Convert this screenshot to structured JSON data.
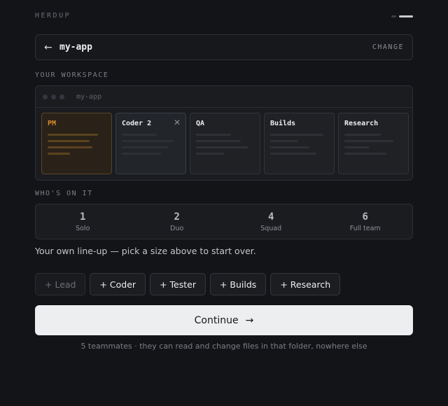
{
  "brand": "HERDUP",
  "repo": {
    "back_icon": "arrow-left-icon",
    "back_glyph": "←",
    "name": "my-app",
    "change_label": "CHANGE"
  },
  "workspace": {
    "label": "YOUR WORKSPACE",
    "window_title": "my-app",
    "panes": [
      {
        "title": "PM",
        "active": true
      },
      {
        "title": "Coder 2",
        "closable": true
      },
      {
        "title": "QA"
      },
      {
        "title": "Builds"
      },
      {
        "title": "Research"
      }
    ],
    "close_glyph": "✕"
  },
  "team": {
    "label": "WHO'S ON IT",
    "sizes": [
      {
        "count": "1",
        "name": "Solo"
      },
      {
        "count": "2",
        "name": "Duo"
      },
      {
        "count": "4",
        "name": "Squad"
      },
      {
        "count": "6",
        "name": "Full team"
      }
    ]
  },
  "lineup_note": "Your own line-up — pick a size above to start over.",
  "roles": [
    {
      "label": "+ Lead",
      "disabled": true
    },
    {
      "label": "+ Coder"
    },
    {
      "label": "+ Tester"
    },
    {
      "label": "+ Builds"
    },
    {
      "label": "+ Research"
    }
  ],
  "continue": {
    "label": "Continue",
    "arrow": "→"
  },
  "footnote": "5 teammates · they can read and change files in that folder, nowhere else",
  "colors": {
    "accent": "#d98c2c",
    "background": "#131417",
    "button": "#eceef0"
  }
}
